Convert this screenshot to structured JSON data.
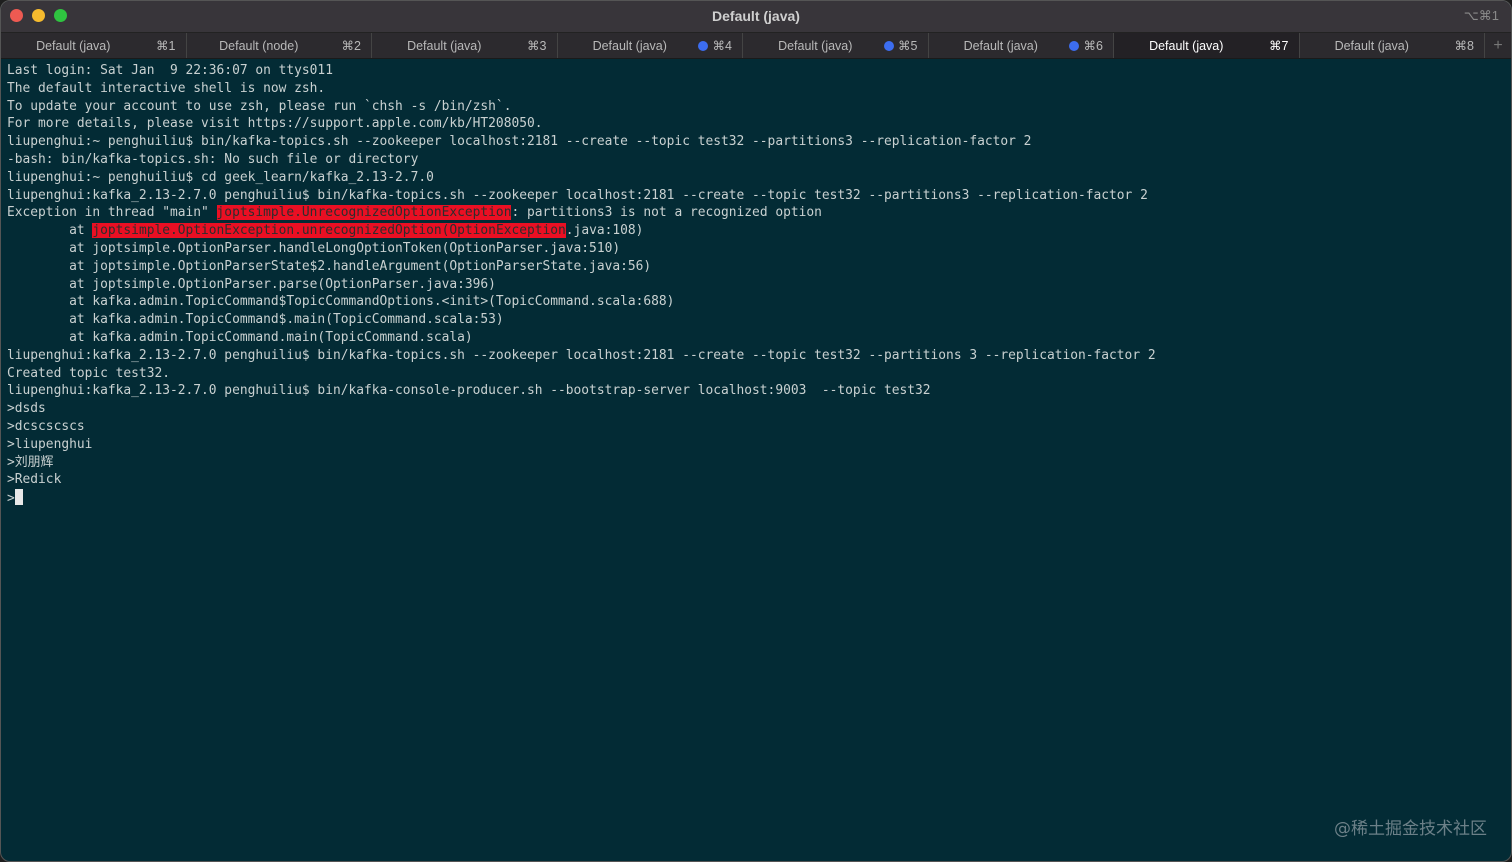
{
  "window": {
    "title": "Default (java)",
    "shortcut": "⌥⌘1"
  },
  "tabs": [
    {
      "label": "Default (java)",
      "key": "⌘1",
      "dot": false,
      "active": false
    },
    {
      "label": "Default (node)",
      "key": "⌘2",
      "dot": false,
      "active": false
    },
    {
      "label": "Default (java)",
      "key": "⌘3",
      "dot": false,
      "active": false
    },
    {
      "label": "Default (java)",
      "key": "⌘4",
      "dot": true,
      "active": false
    },
    {
      "label": "Default (java)",
      "key": "⌘5",
      "dot": true,
      "active": false
    },
    {
      "label": "Default (java)",
      "key": "⌘6",
      "dot": true,
      "active": false
    },
    {
      "label": "Default (java)",
      "key": "⌘7",
      "dot": false,
      "active": true
    },
    {
      "label": "Default (java)",
      "key": "⌘8",
      "dot": false,
      "active": false
    }
  ],
  "new_tab": "+",
  "colors": {
    "dot": "#3c6df0",
    "highlight": "#ea0f23",
    "background": "#032b35"
  },
  "terminal": [
    [
      {
        "t": "Last login: Sat Jan  9 22:36:07 on ttys011"
      }
    ],
    [
      {
        "t": ""
      }
    ],
    [
      {
        "t": "The default interactive shell is now zsh."
      }
    ],
    [
      {
        "t": "To update your account to use zsh, please run `chsh -s /bin/zsh`."
      }
    ],
    [
      {
        "t": "For more details, please visit https://support.apple.com/kb/HT208050."
      }
    ],
    [
      {
        "t": "liupenghui:~ penghuiliu$ bin/kafka-topics.sh --zookeeper localhost:2181 --create --topic test32 --partitions3 --replication-factor 2"
      }
    ],
    [
      {
        "t": "-bash: bin/kafka-topics.sh: No such file or directory"
      }
    ],
    [
      {
        "t": "liupenghui:~ penghuiliu$ cd geek_learn/kafka_2.13-2.7.0"
      }
    ],
    [
      {
        "t": "liupenghui:kafka_2.13-2.7.0 penghuiliu$ bin/kafka-topics.sh --zookeeper localhost:2181 --create --topic test32 --partitions3 --replication-factor 2"
      }
    ],
    [
      {
        "t": "Exception in thread \"main\" "
      },
      {
        "t": "joptsimple.UnrecognizedOptionException",
        "hl": true
      },
      {
        "t": ": partitions3 is not a recognized option"
      }
    ],
    [
      {
        "t": "        at "
      },
      {
        "t": "joptsimple.OptionException.unrecognizedOption(OptionException",
        "hl": true
      },
      {
        "t": ".java:108)"
      }
    ],
    [
      {
        "t": "        at joptsimple.OptionParser.handleLongOptionToken(OptionParser.java:510)"
      }
    ],
    [
      {
        "t": "        at joptsimple.OptionParserState$2.handleArgument(OptionParserState.java:56)"
      }
    ],
    [
      {
        "t": "        at joptsimple.OptionParser.parse(OptionParser.java:396)"
      }
    ],
    [
      {
        "t": "        at kafka.admin.TopicCommand$TopicCommandOptions.<init>(TopicCommand.scala:688)"
      }
    ],
    [
      {
        "t": "        at kafka.admin.TopicCommand$.main(TopicCommand.scala:53)"
      }
    ],
    [
      {
        "t": "        at kafka.admin.TopicCommand.main(TopicCommand.scala)"
      }
    ],
    [
      {
        "t": "liupenghui:kafka_2.13-2.7.0 penghuiliu$ bin/kafka-topics.sh --zookeeper localhost:2181 --create --topic test32 --partitions 3 --replication-factor 2"
      }
    ],
    [
      {
        "t": "Created topic test32."
      }
    ],
    [
      {
        "t": "liupenghui:kafka_2.13-2.7.0 penghuiliu$ bin/kafka-console-producer.sh --bootstrap-server localhost:9003  --topic test32"
      }
    ],
    [
      {
        "t": ">dsds"
      }
    ],
    [
      {
        "t": ">dcscscscs"
      }
    ],
    [
      {
        "t": ">liupenghui"
      }
    ],
    [
      {
        "t": ">刘朋辉"
      }
    ],
    [
      {
        "t": ">Redick"
      }
    ],
    [
      {
        "t": ">"
      }
    ]
  ],
  "watermark": "@稀土掘金技术社区"
}
